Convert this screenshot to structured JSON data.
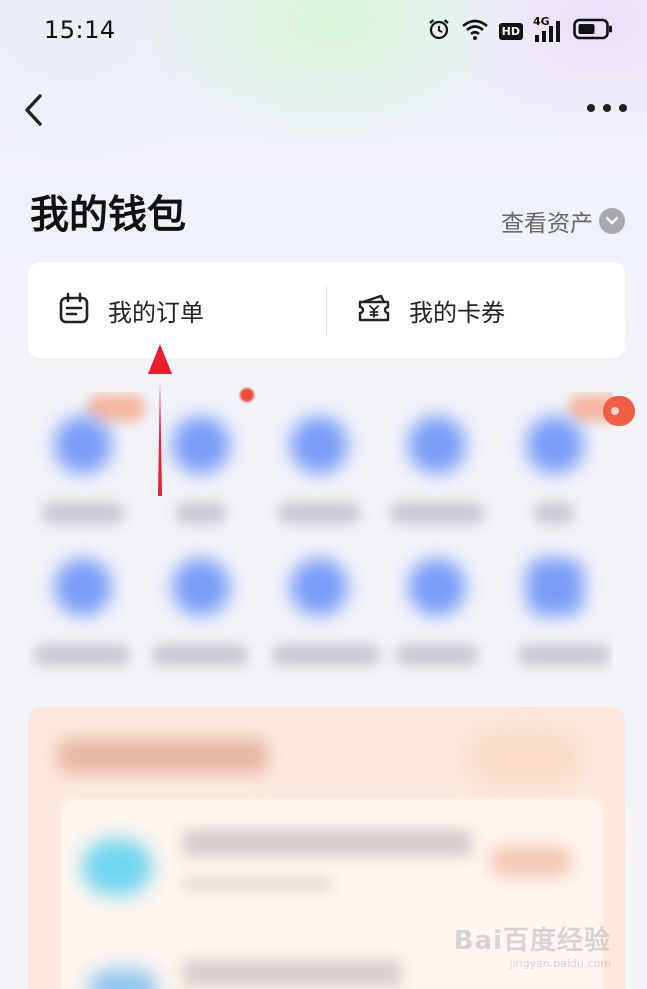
{
  "status_bar": {
    "time": "15:14",
    "icons": [
      "alarm-icon",
      "wifi-icon",
      "hd-icon",
      "cellular-4g-icon",
      "battery-icon"
    ],
    "hd_label": "HD",
    "network_label": "4G"
  },
  "topbar": {
    "back_icon": "chevron-left-icon",
    "more_icon": "more-dots-icon"
  },
  "header": {
    "title": "我的钱包",
    "view_assets_label": "查看资产"
  },
  "quick_card": {
    "items": [
      {
        "label": "我的订单",
        "icon": "order-calendar-icon"
      },
      {
        "label": "我的卡券",
        "icon": "ticket-icon"
      }
    ]
  },
  "watermark": {
    "text": "Bai百度经验",
    "sub": "jingyan.baidu.com"
  },
  "colors": {
    "accent_blue": "#7a9df7",
    "badge_red": "#f25d45",
    "arrow_red": "#e8202e",
    "promo_bg": "#fde8dd"
  }
}
